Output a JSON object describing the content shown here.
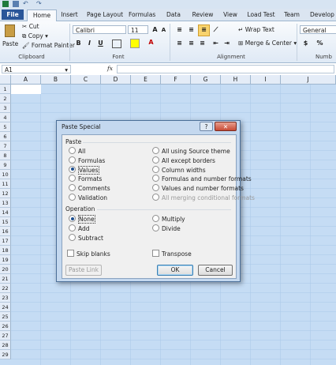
{
  "ribbon": {
    "tabs": [
      "File",
      "Home",
      "Insert",
      "Page Layout",
      "Formulas",
      "Data",
      "Review",
      "View",
      "Load Test",
      "Team",
      "Develop"
    ],
    "clipboard": {
      "paste": "Paste",
      "cut": "Cut",
      "copy": "Copy",
      "format_painter": "Format Painter",
      "label": "Clipboard"
    },
    "font": {
      "name": "Calibri",
      "size": "11",
      "bold": "B",
      "italic": "I",
      "underline": "U",
      "label": "Font"
    },
    "alignment": {
      "wrap_text": "Wrap Text",
      "merge": "Merge & Center",
      "label": "Alignment"
    },
    "number": {
      "format": "General",
      "currency": "$",
      "percent": "%",
      "label": "Numb"
    }
  },
  "formula_bar": {
    "name_box": "A1",
    "fx": "fx"
  },
  "grid": {
    "columns": [
      "A",
      "B",
      "C",
      "D",
      "E",
      "F",
      "G",
      "H",
      "I",
      "J"
    ],
    "rows": [
      "1",
      "2",
      "3",
      "4",
      "5",
      "6",
      "7",
      "8",
      "9",
      "10",
      "11",
      "12",
      "13",
      "14",
      "15",
      "16",
      "17",
      "18",
      "19",
      "20",
      "21",
      "22",
      "23",
      "24",
      "25",
      "26",
      "27",
      "28",
      "29"
    ]
  },
  "dialog": {
    "title": "Paste Special",
    "help": "?",
    "close": "✕",
    "paste_heading": "Paste",
    "paste_left": [
      {
        "label": "All",
        "selected": false
      },
      {
        "label": "Formulas",
        "selected": false
      },
      {
        "label": "Values",
        "selected": true
      },
      {
        "label": "Formats",
        "selected": false
      },
      {
        "label": "Comments",
        "selected": false
      },
      {
        "label": "Validation",
        "selected": false
      }
    ],
    "paste_right": [
      {
        "label": "All using Source theme",
        "enabled": true
      },
      {
        "label": "All except borders",
        "enabled": true
      },
      {
        "label": "Column widths",
        "enabled": true
      },
      {
        "label": "Formulas and number formats",
        "enabled": true
      },
      {
        "label": "Values and number formats",
        "enabled": true
      },
      {
        "label": "All merging conditional formats",
        "enabled": false
      }
    ],
    "operation_heading": "Operation",
    "op_left": [
      {
        "label": "None",
        "selected": true
      },
      {
        "label": "Add",
        "selected": false
      },
      {
        "label": "Subtract",
        "selected": false
      }
    ],
    "op_right": [
      {
        "label": "Multiply",
        "selected": false
      },
      {
        "label": "Divide",
        "selected": false
      }
    ],
    "skip_blanks": "Skip blanks",
    "transpose": "Transpose",
    "paste_link": "Paste Link",
    "ok": "OK",
    "cancel": "Cancel"
  },
  "colors": {
    "ribbon_accent": "#2a5699",
    "selection": "#c5dcf4",
    "header": "#e4ecf7"
  }
}
